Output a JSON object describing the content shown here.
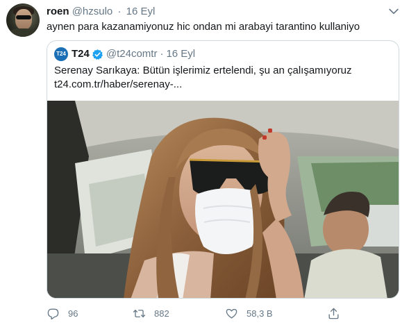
{
  "tweet": {
    "author": {
      "display_name": "roen",
      "handle": "@hzsulo",
      "separator": "·",
      "date": "16 Eyl"
    },
    "text": "aynen para kazanamiyonuz hic ondan mi arabayi tarantino kullaniyo",
    "more_icon": "chevron-down-icon"
  },
  "quote": {
    "avatar_text": "T24",
    "display_name": "T24",
    "verified_icon": "verified-badge-icon",
    "handle": "@t24comtr",
    "separator": "·",
    "date": "16 Eyl",
    "text_line1": "Serenay Sarıkaya: Bütün işlerimiz ertelendi, şu an çalışamıyoruz",
    "text_line2": "t24.com.tr/haber/serenay-...",
    "image_subject": "woman-in-car-with-face-mask-photo"
  },
  "actions": {
    "reply": {
      "icon": "reply-icon",
      "count": "96"
    },
    "retweet": {
      "icon": "retweet-icon",
      "count": "882"
    },
    "like": {
      "icon": "heart-icon",
      "count": "58,3 B"
    },
    "share": {
      "icon": "share-icon"
    }
  },
  "colors": {
    "secondary_text": "#657786",
    "primary_text": "#14171a",
    "border": "#cfd9de",
    "verified": "#1da1f2"
  }
}
